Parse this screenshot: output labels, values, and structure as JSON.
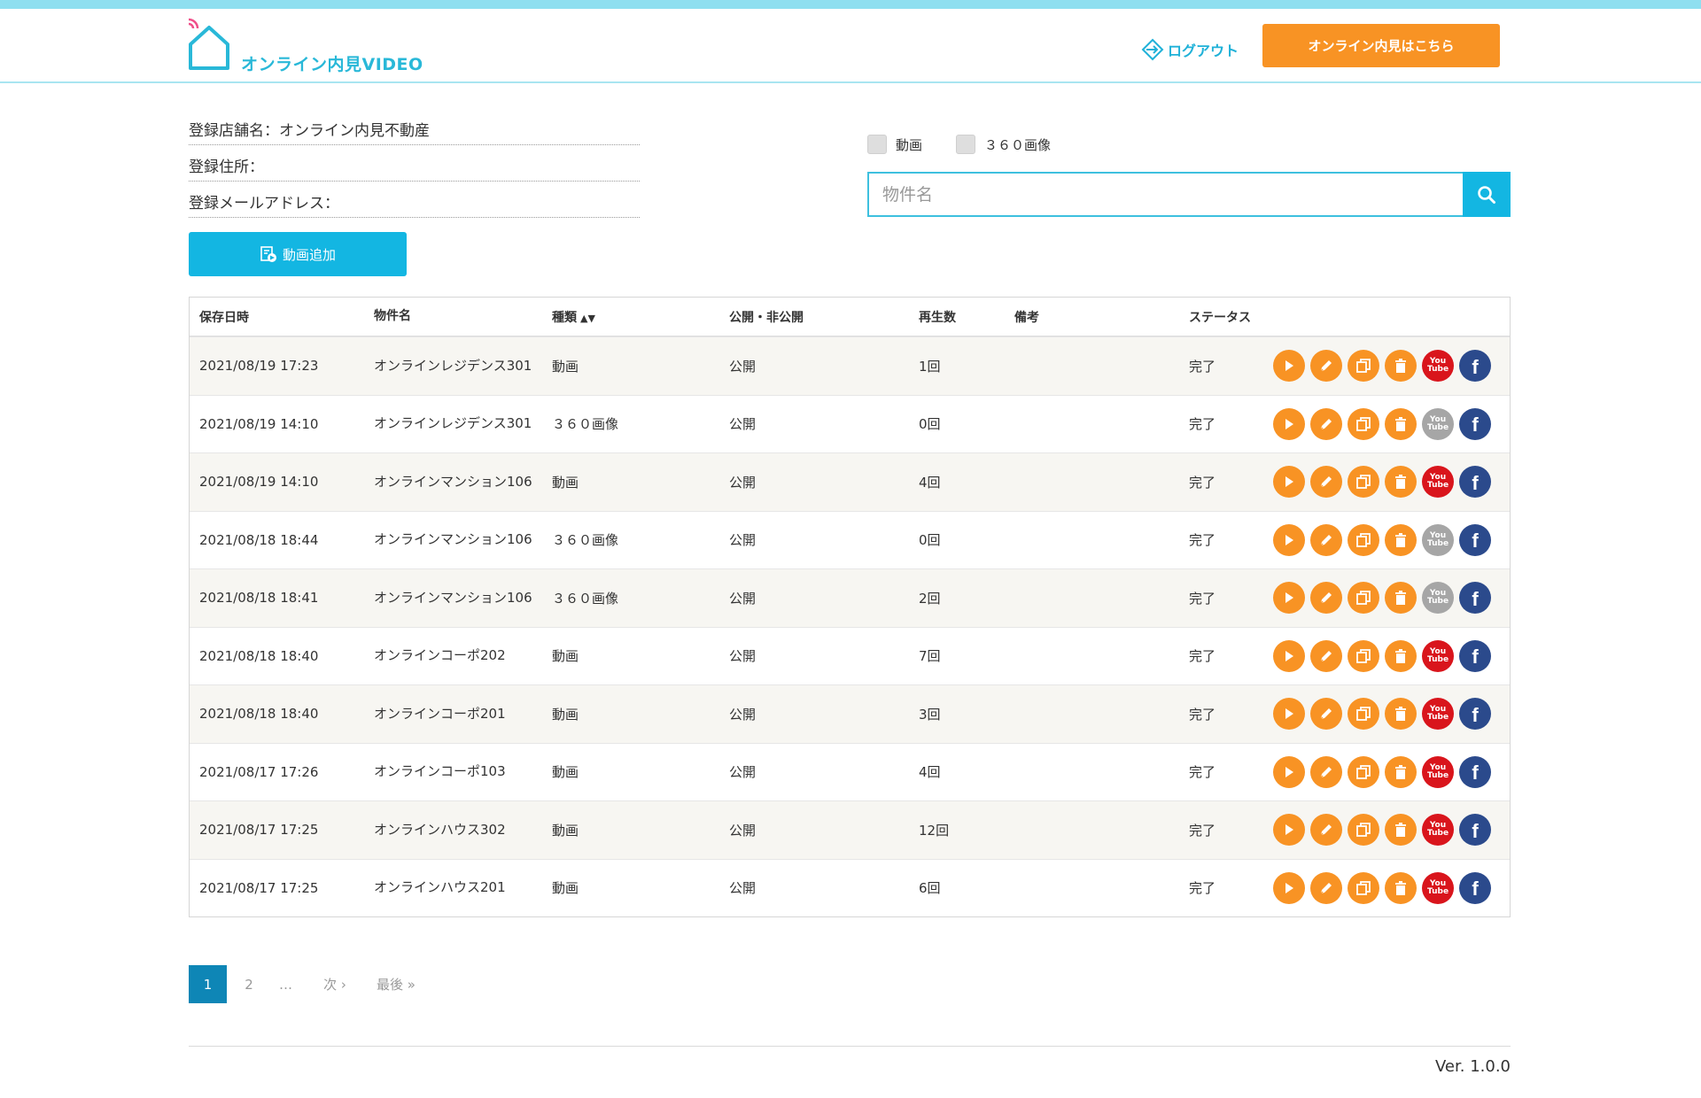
{
  "header": {
    "logo_text": "オンライン内見VIDEO",
    "logout_label": "ログアウト",
    "cta_label": "オンライン内見はこちら"
  },
  "info": {
    "store": "登録店舗名：オンライン内見不動産",
    "address": "登録住所：",
    "email": "登録メールアドレス："
  },
  "add_button_label": "動画追加",
  "filters": {
    "video_label": "動画",
    "image360_label": "３６０画像"
  },
  "search": {
    "placeholder": "物件名"
  },
  "table": {
    "headers": {
      "date": "保存日時",
      "name": "物件名",
      "type": "種類",
      "visibility": "公開・非公開",
      "plays": "再生数",
      "note": "備考",
      "status": "ステータス"
    },
    "rows": [
      {
        "date": "2021/08/19 17:23",
        "name": "オンラインレジデンス301",
        "type": "動画",
        "visibility": "公開",
        "plays": "1回",
        "note": "",
        "status": "完了",
        "youtube": "active"
      },
      {
        "date": "2021/08/19 14:10",
        "name": "オンラインレジデンス301",
        "type": "３６０画像",
        "visibility": "公開",
        "plays": "0回",
        "note": "",
        "status": "完了",
        "youtube": "disabled"
      },
      {
        "date": "2021/08/19 14:10",
        "name": "オンラインマンション106",
        "type": "動画",
        "visibility": "公開",
        "plays": "4回",
        "note": "",
        "status": "完了",
        "youtube": "active"
      },
      {
        "date": "2021/08/18 18:44",
        "name": "オンラインマンション106",
        "type": "３６０画像",
        "visibility": "公開",
        "plays": "0回",
        "note": "",
        "status": "完了",
        "youtube": "disabled"
      },
      {
        "date": "2021/08/18 18:41",
        "name": "オンラインマンション106",
        "type": "３６０画像",
        "visibility": "公開",
        "plays": "2回",
        "note": "",
        "status": "完了",
        "youtube": "disabled"
      },
      {
        "date": "2021/08/18 18:40",
        "name": "オンラインコーポ202",
        "type": "動画",
        "visibility": "公開",
        "plays": "7回",
        "note": "",
        "status": "完了",
        "youtube": "active"
      },
      {
        "date": "2021/08/18 18:40",
        "name": "オンラインコーポ201",
        "type": "動画",
        "visibility": "公開",
        "plays": "3回",
        "note": "",
        "status": "完了",
        "youtube": "active"
      },
      {
        "date": "2021/08/17 17:26",
        "name": "オンラインコーポ103",
        "type": "動画",
        "visibility": "公開",
        "plays": "4回",
        "note": "",
        "status": "完了",
        "youtube": "active"
      },
      {
        "date": "2021/08/17 17:25",
        "name": "オンラインハウス302",
        "type": "動画",
        "visibility": "公開",
        "plays": "12回",
        "note": "",
        "status": "完了",
        "youtube": "active"
      },
      {
        "date": "2021/08/17 17:25",
        "name": "オンラインハウス201",
        "type": "動画",
        "visibility": "公開",
        "plays": "6回",
        "note": "",
        "status": "完了",
        "youtube": "active"
      }
    ]
  },
  "icons": {
    "youtube_text": "You Tube",
    "facebook_text": "f"
  },
  "pagination": {
    "pages": [
      "1",
      "2",
      "…"
    ],
    "next": "次 ›",
    "last": "最後 »"
  },
  "version": "Ver. 1.0.0",
  "colors": {
    "accent": "#13b6e2",
    "cta": "#f89324",
    "youtube": "#d9151c",
    "facebook": "#2b4a8c",
    "disabled": "#a6a6a6"
  }
}
